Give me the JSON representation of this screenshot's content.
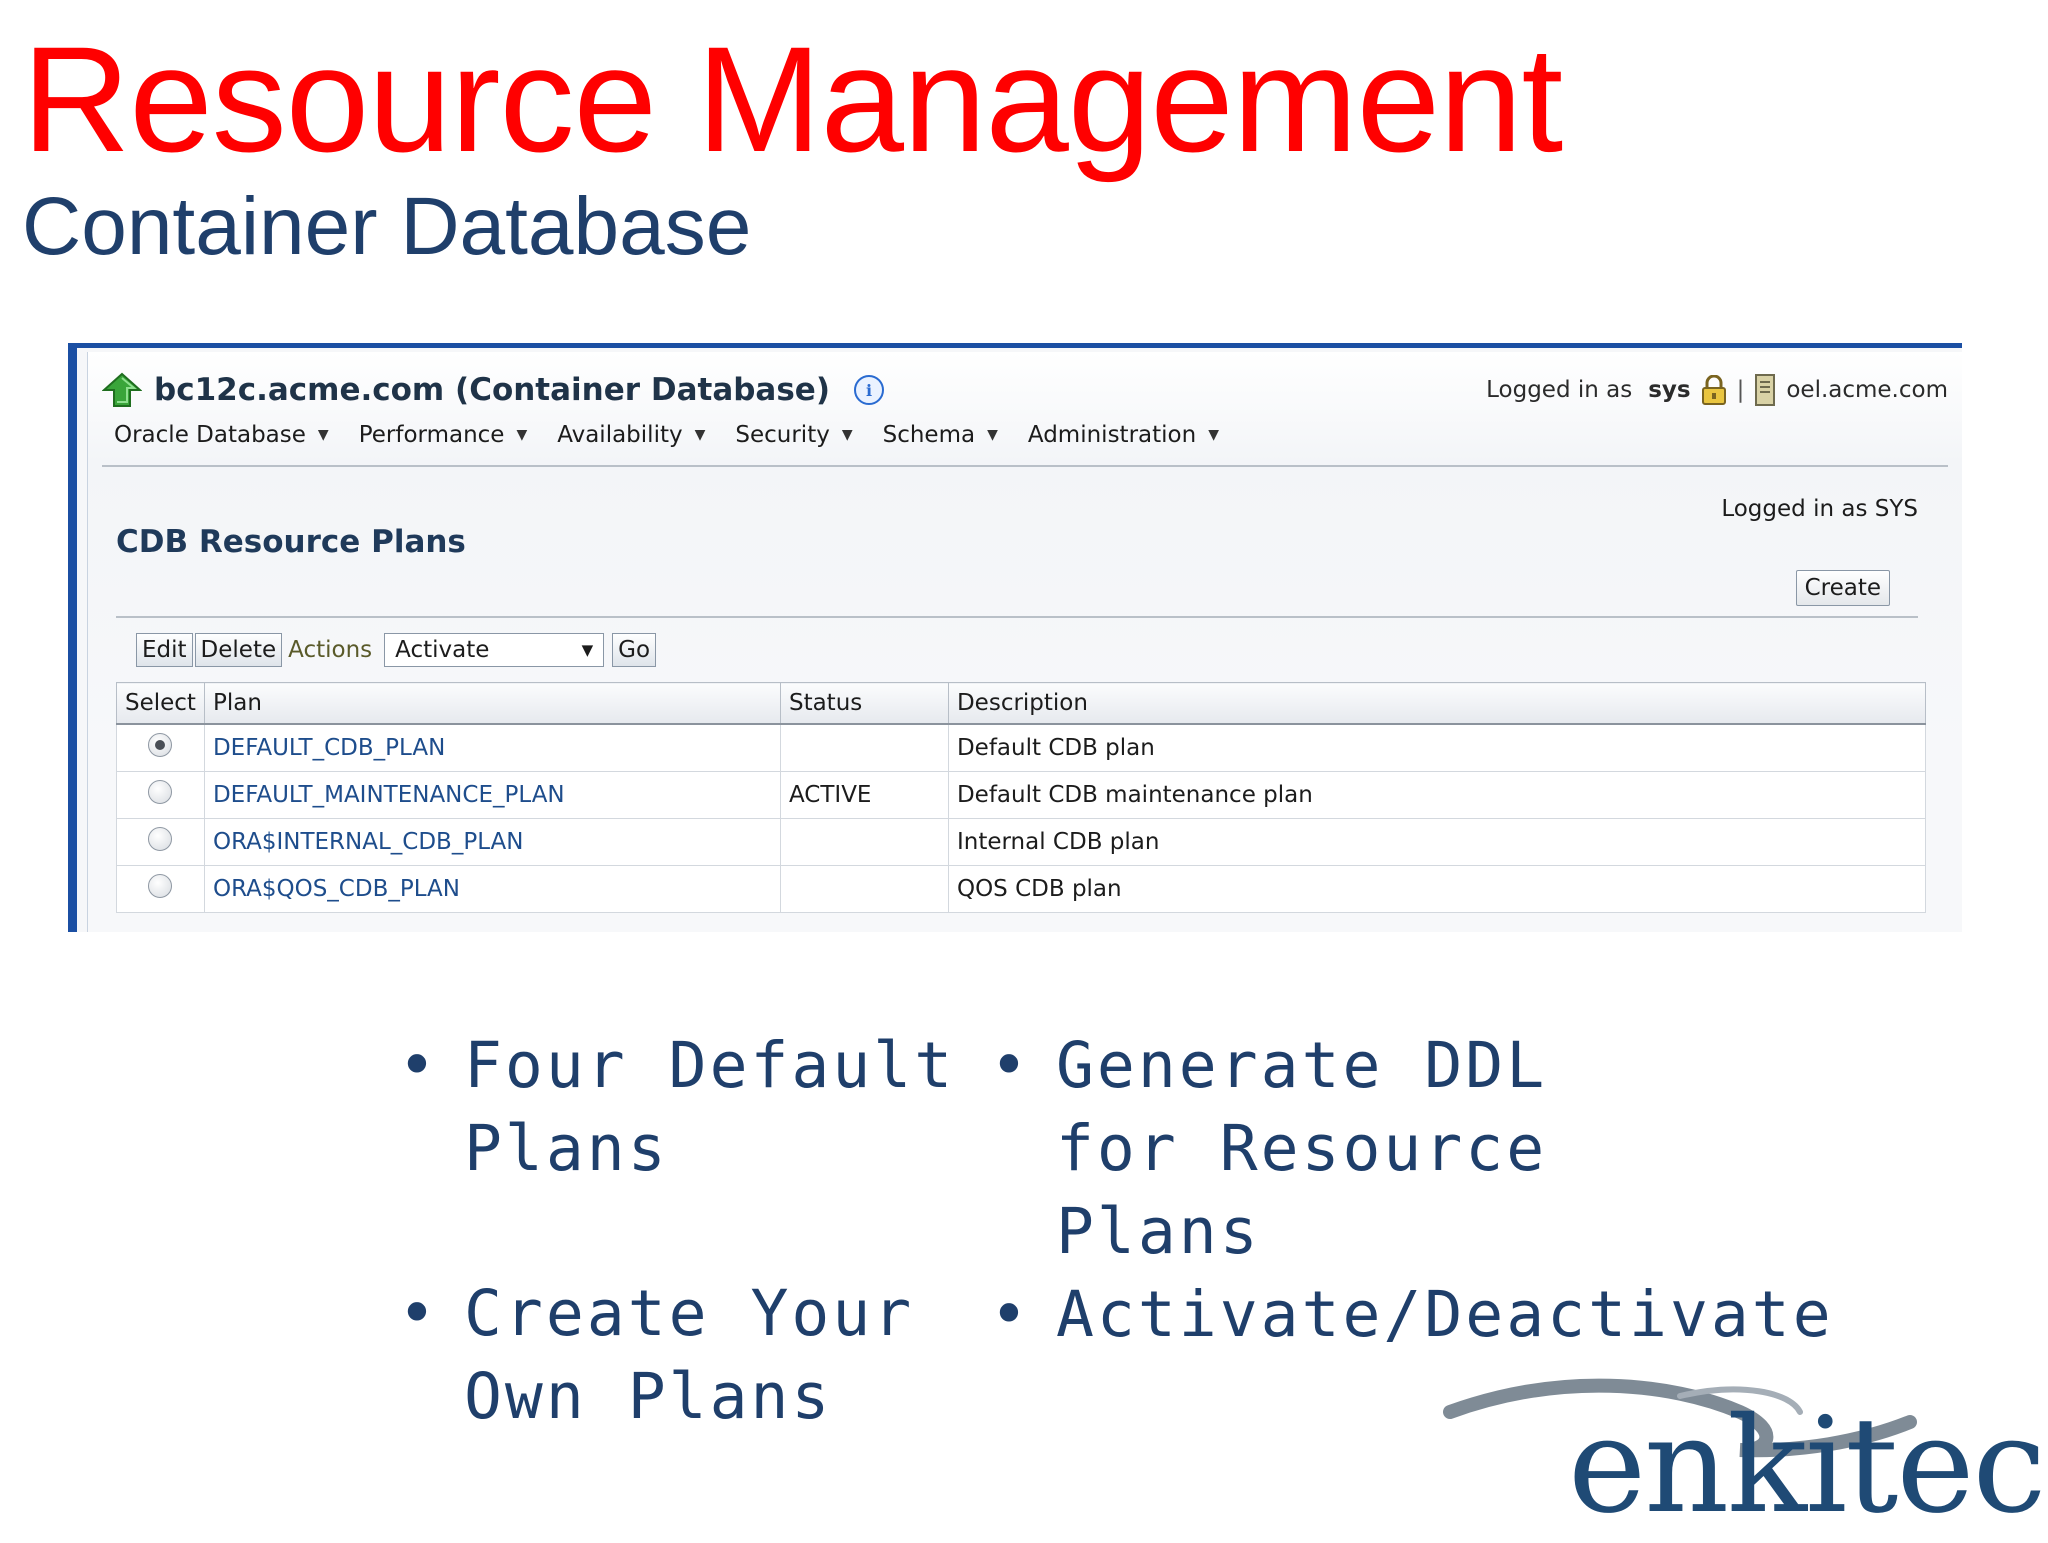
{
  "slide": {
    "title": "Resource Management",
    "subtitle": "Container Database"
  },
  "app": {
    "db_title": "bc12c.acme.com (Container Database)",
    "logged_in_prefix": "Logged in as",
    "logged_in_user": "sys",
    "separator": "|",
    "host": "oel.acme.com",
    "menu": [
      {
        "label": "Oracle Database"
      },
      {
        "label": "Performance"
      },
      {
        "label": "Availability"
      },
      {
        "label": "Security"
      },
      {
        "label": "Schema"
      },
      {
        "label": "Administration"
      }
    ],
    "login_sys": "Logged in as SYS",
    "section_title": "CDB Resource Plans",
    "create_label": "Create",
    "toolbar": {
      "edit": "Edit",
      "delete": "Delete",
      "actions_label": "Actions",
      "selected_action": "Activate",
      "go": "Go"
    },
    "table": {
      "headers": [
        "Select",
        "Plan",
        "Status",
        "Description"
      ],
      "rows": [
        {
          "selected": true,
          "plan": "DEFAULT_CDB_PLAN",
          "status": "",
          "description": "Default CDB plan"
        },
        {
          "selected": false,
          "plan": "DEFAULT_MAINTENANCE_PLAN",
          "status": "ACTIVE",
          "description": "Default CDB maintenance plan"
        },
        {
          "selected": false,
          "plan": "ORA$INTERNAL_CDB_PLAN",
          "status": "",
          "description": "Internal CDB plan"
        },
        {
          "selected": false,
          "plan": "ORA$QOS_CDB_PLAN",
          "status": "",
          "description": "QOS CDB plan"
        }
      ]
    }
  },
  "bullets": {
    "left": [
      "Four Default Plans",
      "Create Your Own Plans"
    ],
    "right": [
      "Generate DDL for Resource Plans",
      "Activate/Deactivate"
    ]
  },
  "logo": {
    "text": "enkitec"
  },
  "colors": {
    "title_red": "#ff0000",
    "navy": "#1f3f6b",
    "frame_blue": "#1b4fa3",
    "link_blue": "#1e4d8c",
    "home_green": "#3aa53a"
  },
  "icons": [
    "home-arrow-icon",
    "info-icon",
    "lock-icon",
    "server-icon",
    "chevron-down-icon",
    "radio-button"
  ]
}
